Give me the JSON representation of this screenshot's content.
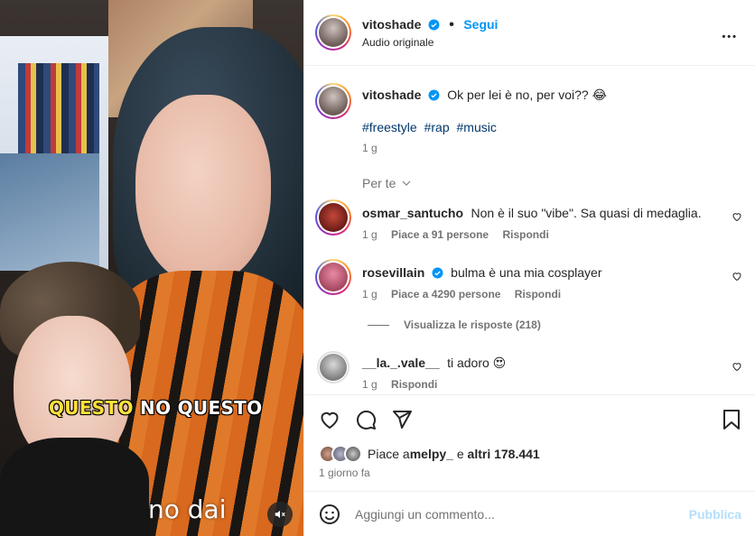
{
  "colors": {
    "accent": "#0095f6",
    "text": "#262626",
    "secondary": "#737373",
    "hashtag": "#00376b",
    "publish_disabled": "#b2dffc"
  },
  "media": {
    "caption_word1": "QUESTO",
    "caption_word2": "NO QUESTO",
    "subtitle": "no dai",
    "mute_icon": "speaker-muted-icon"
  },
  "header": {
    "username": "vitoshade",
    "separator": "•",
    "follow_label": "Segui",
    "audio": "Audio originale",
    "more_icon": "more-horizontal-icon",
    "more_label": "•••"
  },
  "post": {
    "username": "vitoshade",
    "text": "Ok per lei è no, per voi?? 😂",
    "hashtags": [
      "#freestyle",
      "#rap",
      "#music"
    ],
    "time": "1 g"
  },
  "sort_label": "Per te",
  "comments": [
    {
      "username": "osmar_santucho",
      "verified": false,
      "text": "Non è il suo \"vibe\". Sa quasi di medaglia.",
      "time": "1 g",
      "likes": "Piace a 91 persone",
      "reply": "Rispondi"
    },
    {
      "username": "rosevillain",
      "verified": true,
      "text": "bulma è una mia cosplayer",
      "time": "1 g",
      "likes": "Piace a 4290 persone",
      "reply": "Rispondi"
    },
    {
      "username": "__la._.vale__",
      "verified": false,
      "text": "ti adoro 😍",
      "time": "1 g",
      "likes": "",
      "reply": "Rispondi"
    }
  ],
  "view_replies": "Visualizza le risposte (218)",
  "actions": {
    "like_icon": "heart-icon",
    "comment_icon": "comment-icon",
    "share_icon": "send-icon",
    "save_icon": "bookmark-icon"
  },
  "likes": {
    "prefix": "Piace a ",
    "user": "melpy_",
    "middle": " e ",
    "rest": "altri 178.441"
  },
  "posted_when": "1 giorno fa",
  "composer": {
    "emoji_icon": "smiley-icon",
    "placeholder": "Aggiungi un commento...",
    "publish": "Pubblica"
  }
}
